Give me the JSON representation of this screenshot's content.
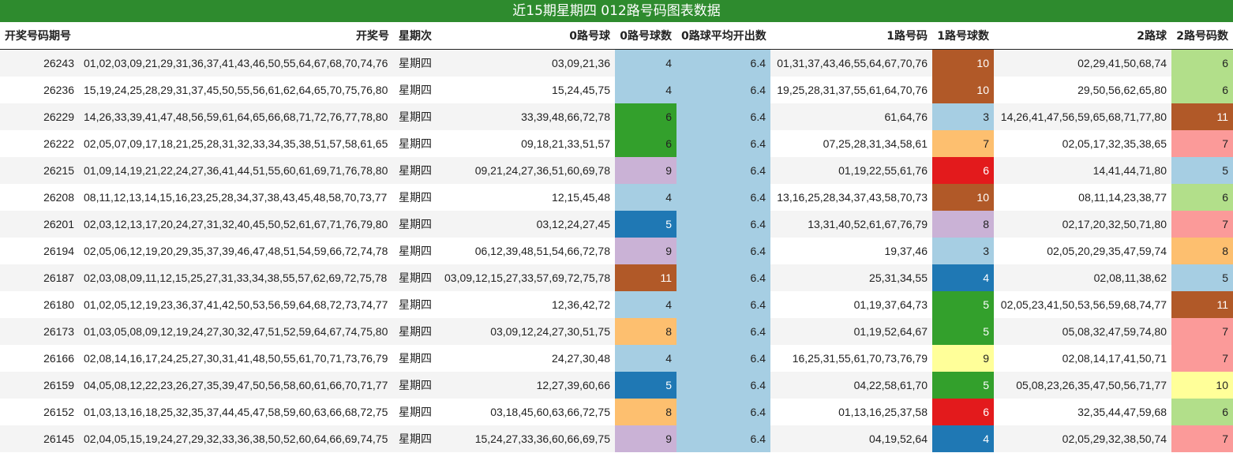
{
  "chart_data": {
    "type": "table",
    "title": "近15期星期四 012路号码图表数据",
    "columns": [
      "开奖号码期号",
      "开奖号",
      "星期次",
      "0路号球",
      "0路号球数",
      "0路球平均开出数",
      "1路号码",
      "1路号球数",
      "2路球",
      "2路号码数"
    ],
    "rows": [
      {
        "period": "26243",
        "numbers": "01,02,03,09,21,29,31,36,37,41,43,46,50,55,64,67,68,70,74,76",
        "weekday": "星期四",
        "r0": "03,09,21,36",
        "c0": "4",
        "avg": "6.4",
        "r1": "01,31,37,43,46,55,64,67,70,76",
        "c1": "10",
        "r2": "02,29,41,50,68,74",
        "c2": "6"
      },
      {
        "period": "26236",
        "numbers": "15,19,24,25,28,29,31,37,45,50,55,56,61,62,64,65,70,75,76,80",
        "weekday": "星期四",
        "r0": "15,24,45,75",
        "c0": "4",
        "avg": "6.4",
        "r1": "19,25,28,31,37,55,61,64,70,76",
        "c1": "10",
        "r2": "29,50,56,62,65,80",
        "c2": "6"
      },
      {
        "period": "26229",
        "numbers": "14,26,33,39,41,47,48,56,59,61,64,65,66,68,71,72,76,77,78,80",
        "weekday": "星期四",
        "r0": "33,39,48,66,72,78",
        "c0": "6",
        "avg": "6.4",
        "r1": "61,64,76",
        "c1": "3",
        "r2": "14,26,41,47,56,59,65,68,71,77,80",
        "c2": "11"
      },
      {
        "period": "26222",
        "numbers": "02,05,07,09,17,18,21,25,28,31,32,33,34,35,38,51,57,58,61,65",
        "weekday": "星期四",
        "r0": "09,18,21,33,51,57",
        "c0": "6",
        "avg": "6.4",
        "r1": "07,25,28,31,34,58,61",
        "c1": "7",
        "r2": "02,05,17,32,35,38,65",
        "c2": "7"
      },
      {
        "period": "26215",
        "numbers": "01,09,14,19,21,22,24,27,36,41,44,51,55,60,61,69,71,76,78,80",
        "weekday": "星期四",
        "r0": "09,21,24,27,36,51,60,69,78",
        "c0": "9",
        "avg": "6.4",
        "r1": "01,19,22,55,61,76",
        "c1": "6",
        "r2": "14,41,44,71,80",
        "c2": "5"
      },
      {
        "period": "26208",
        "numbers": "08,11,12,13,14,15,16,23,25,28,34,37,38,43,45,48,58,70,73,77",
        "weekday": "星期四",
        "r0": "12,15,45,48",
        "c0": "4",
        "avg": "6.4",
        "r1": "13,16,25,28,34,37,43,58,70,73",
        "c1": "10",
        "r2": "08,11,14,23,38,77",
        "c2": "6"
      },
      {
        "period": "26201",
        "numbers": "02,03,12,13,17,20,24,27,31,32,40,45,50,52,61,67,71,76,79,80",
        "weekday": "星期四",
        "r0": "03,12,24,27,45",
        "c0": "5",
        "avg": "6.4",
        "r1": "13,31,40,52,61,67,76,79",
        "c1": "8",
        "r2": "02,17,20,32,50,71,80",
        "c2": "7"
      },
      {
        "period": "26194",
        "numbers": "02,05,06,12,19,20,29,35,37,39,46,47,48,51,54,59,66,72,74,78",
        "weekday": "星期四",
        "r0": "06,12,39,48,51,54,66,72,78",
        "c0": "9",
        "avg": "6.4",
        "r1": "19,37,46",
        "c1": "3",
        "r2": "02,05,20,29,35,47,59,74",
        "c2": "8"
      },
      {
        "period": "26187",
        "numbers": "02,03,08,09,11,12,15,25,27,31,33,34,38,55,57,62,69,72,75,78",
        "weekday": "星期四",
        "r0": "03,09,12,15,27,33,57,69,72,75,78",
        "c0": "11",
        "avg": "6.4",
        "r1": "25,31,34,55",
        "c1": "4",
        "r2": "02,08,11,38,62",
        "c2": "5"
      },
      {
        "period": "26180",
        "numbers": "01,02,05,12,19,23,36,37,41,42,50,53,56,59,64,68,72,73,74,77",
        "weekday": "星期四",
        "r0": "12,36,42,72",
        "c0": "4",
        "avg": "6.4",
        "r1": "01,19,37,64,73",
        "c1": "5",
        "r2": "02,05,23,41,50,53,56,59,68,74,77",
        "c2": "11"
      },
      {
        "period": "26173",
        "numbers": "01,03,05,08,09,12,19,24,27,30,32,47,51,52,59,64,67,74,75,80",
        "weekday": "星期四",
        "r0": "03,09,12,24,27,30,51,75",
        "c0": "8",
        "avg": "6.4",
        "r1": "01,19,52,64,67",
        "c1": "5",
        "r2": "05,08,32,47,59,74,80",
        "c2": "7"
      },
      {
        "period": "26166",
        "numbers": "02,08,14,16,17,24,25,27,30,31,41,48,50,55,61,70,71,73,76,79",
        "weekday": "星期四",
        "r0": "24,27,30,48",
        "c0": "4",
        "avg": "6.4",
        "r1": "16,25,31,55,61,70,73,76,79",
        "c1": "9",
        "r2": "02,08,14,17,41,50,71",
        "c2": "7"
      },
      {
        "period": "26159",
        "numbers": "04,05,08,12,22,23,26,27,35,39,47,50,56,58,60,61,66,70,71,77",
        "weekday": "星期四",
        "r0": "12,27,39,60,66",
        "c0": "5",
        "avg": "6.4",
        "r1": "04,22,58,61,70",
        "c1": "5",
        "r2": "05,08,23,26,35,47,50,56,71,77",
        "c2": "10"
      },
      {
        "period": "26152",
        "numbers": "01,03,13,16,18,25,32,35,37,44,45,47,58,59,60,63,66,68,72,75",
        "weekday": "星期四",
        "r0": "03,18,45,60,63,66,72,75",
        "c0": "8",
        "avg": "6.4",
        "r1": "01,13,16,25,37,58",
        "c1": "6",
        "r2": "32,35,44,47,59,68",
        "c2": "6"
      },
      {
        "period": "26145",
        "numbers": "02,04,05,15,19,24,27,29,32,33,36,38,50,52,60,64,66,69,74,75",
        "weekday": "星期四",
        "r0": "15,24,27,33,36,60,66,69,75",
        "c0": "9",
        "avg": "6.4",
        "r1": "04,19,52,64",
        "c1": "4",
        "r2": "02,05,29,32,38,50,74",
        "c2": "7"
      }
    ]
  },
  "count_colors": {
    "3": "#a6cee3",
    "4": "#1f78b4",
    "5": "#33a02c",
    "6": "#e31a1c",
    "7": "#fdbf6f",
    "8": "#cab2d6",
    "9": "#ffff99",
    "10": "#b15928",
    "11": "#b15928"
  },
  "c0_colors": {
    "4": "#a6cee3",
    "5": "#1f78b4",
    "6": "#33a02c",
    "8": "#fdbf6f",
    "9": "#cab2d6",
    "11": "#b15928"
  },
  "c2_colors": {
    "5": "#a6cee3",
    "6": "#b2df8a",
    "7": "#fb9a99",
    "8": "#fdbf6f",
    "10": "#ffff99",
    "11": "#b15928"
  },
  "light_text_counts": [
    "4",
    "5",
    "6",
    "10",
    "11"
  ]
}
